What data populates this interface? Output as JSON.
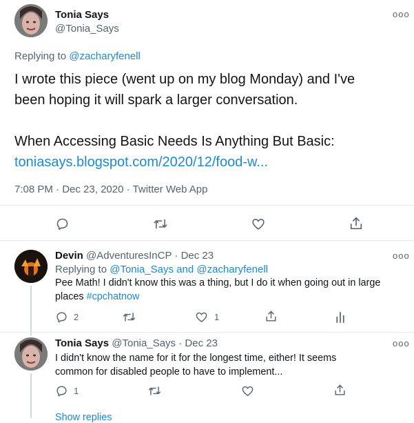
{
  "main_tweet": {
    "author_name": "Tonia Says",
    "handle": "@Tonia_Says",
    "replying_prefix": "Replying to ",
    "replying_to": "@zacharyfenell",
    "text_line1": "I wrote this piece (went up on my blog Monday) and I've",
    "text_line2": "been hoping it will spark a larger conversation.",
    "text_line3": "When Accessing Basic Needs Is Anything But Basic:",
    "link": "toniasays.blogspot.com/2020/12/food-w...",
    "time": "7:08 PM",
    "sep1": "·",
    "date": "Dec 23, 2020",
    "sep2": "·",
    "source": "Twitter Web App"
  },
  "reply1": {
    "author_name": "Devin",
    "handle": "@AdventuresInCP",
    "sep": "·",
    "date": "Dec 23",
    "replying_prefix": "Replying to ",
    "replying_to_a": "@Tonia_Says",
    "and_text": " and ",
    "replying_to_b": "@zacharyfenell",
    "text_line1": "Pee Math! I didn't know this was a thing, but I do it when going out in large",
    "text_line2_prefix": "places ",
    "hashtag": "#cpchatnow",
    "reply_count": "2",
    "like_count": "1"
  },
  "reply2": {
    "author_name": "Tonia Says",
    "handle": "@Tonia_Says",
    "sep": "·",
    "date": "Dec 23",
    "text_line1": "I didn't know the name for it for the longest time, either!  It seems",
    "text_line2": "common for disabled people to have to implement...",
    "reply_count": "1"
  },
  "show_replies": "Show replies",
  "more_glyph": "ooo",
  "colors": {
    "link": "#1b8ad1",
    "muted": "#536471",
    "divider": "#e6ecf0"
  },
  "icons": [
    "more-icon",
    "reply-icon",
    "retweet-icon",
    "like-icon",
    "share-icon",
    "analytics-icon"
  ]
}
